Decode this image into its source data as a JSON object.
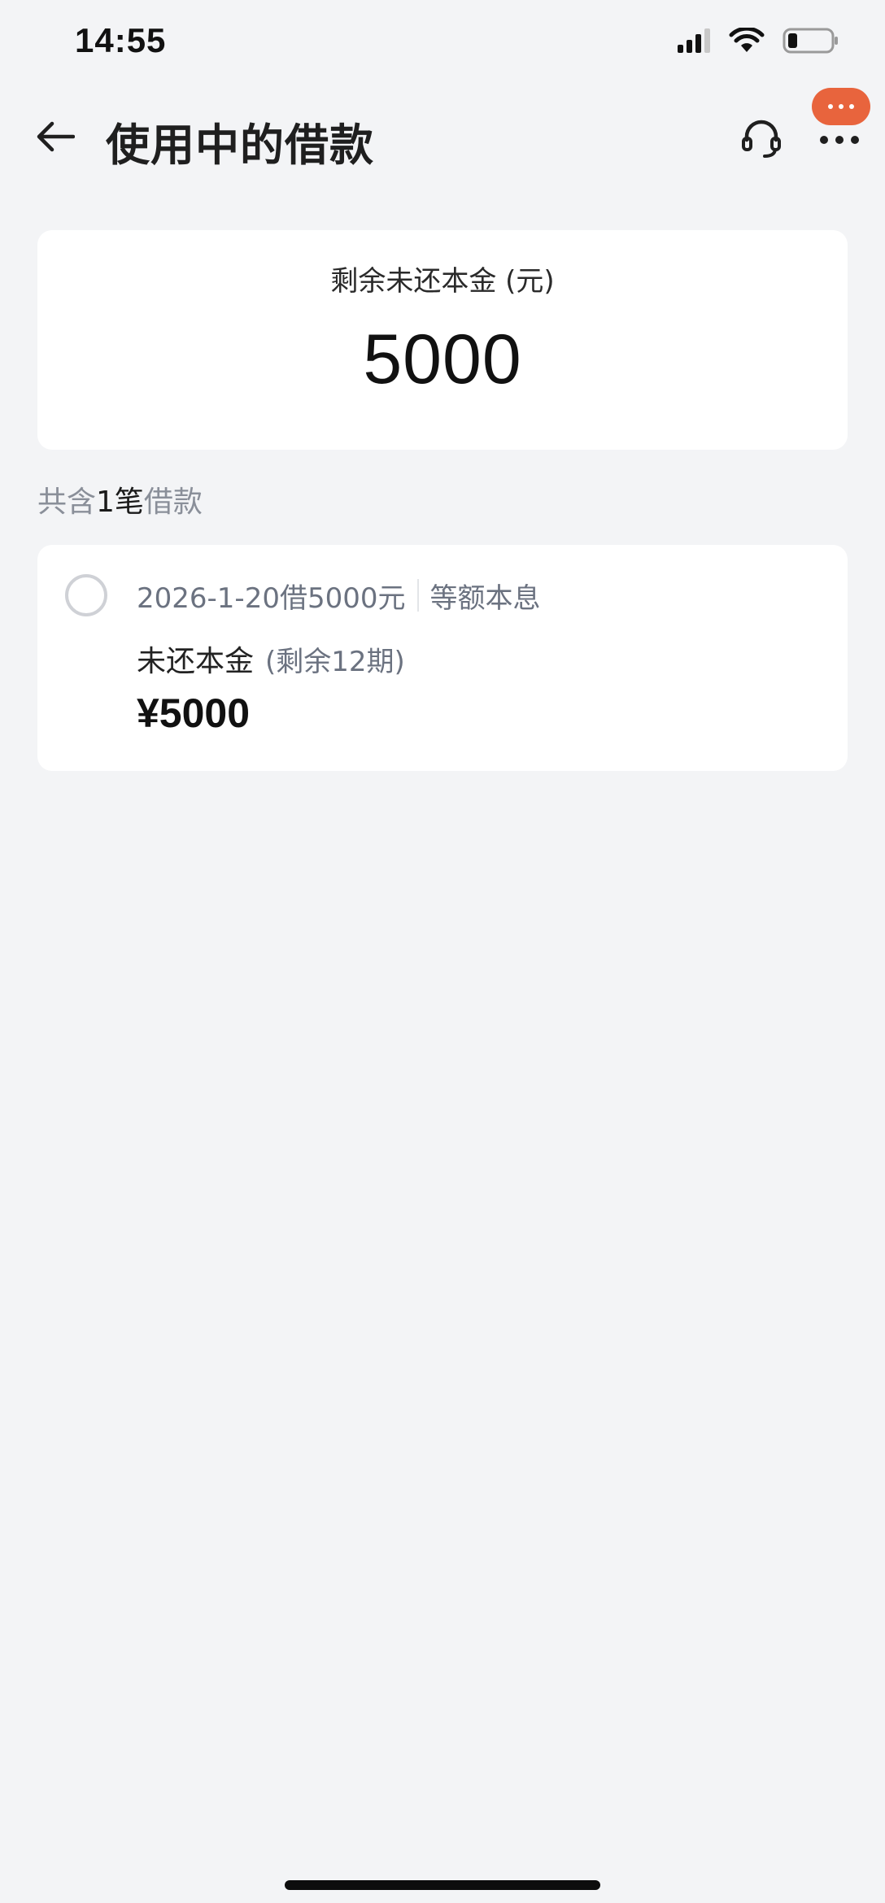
{
  "status_bar": {
    "time": "14:55",
    "icons": [
      "signal-icon",
      "wifi-icon",
      "battery-icon"
    ],
    "battery_level": 0.2
  },
  "nav": {
    "title": "使用中的借款",
    "back_icon": "arrow-left-icon",
    "service_icon": "headset-icon",
    "more_icon": "more-dots-icon",
    "notify_color": "#e8643d"
  },
  "summary": {
    "label": "剩余未还本金 (元)",
    "amount": "5000"
  },
  "loan_count": {
    "prefix": "共含",
    "count": "1笔",
    "suffix": "借款"
  },
  "loans": [
    {
      "title": "2026-1-20借5000元",
      "method": "等额本息",
      "principal_label": "未还本金",
      "remaining_periods": "(剩余12期)",
      "amount": "¥5000",
      "selected": false
    }
  ]
}
